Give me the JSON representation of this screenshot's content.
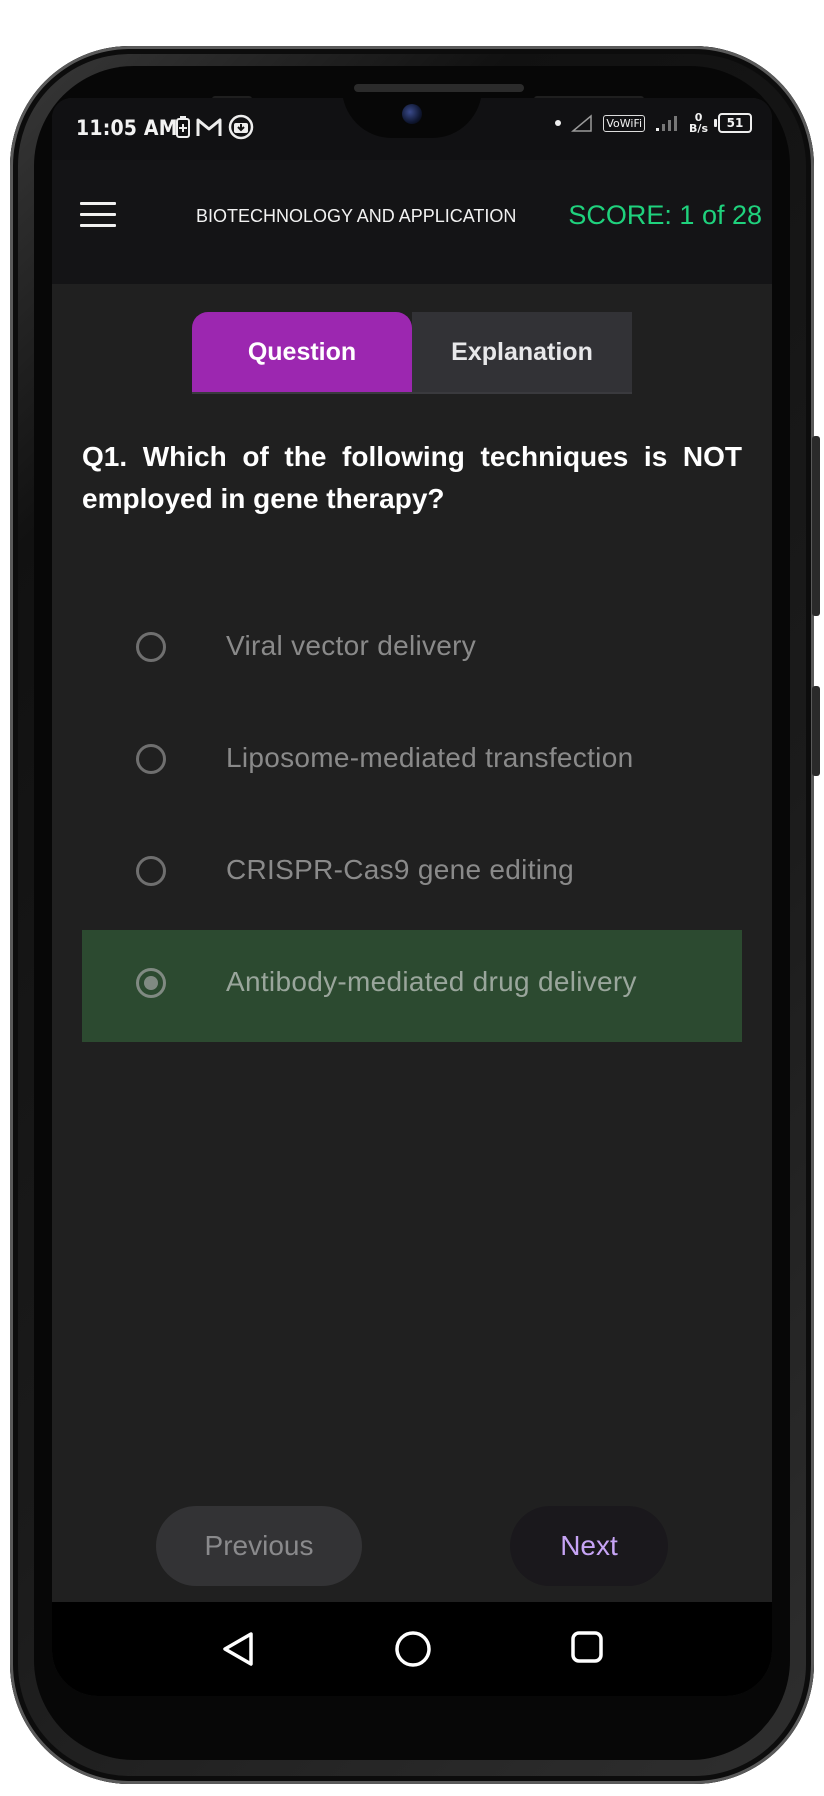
{
  "status_bar": {
    "time": "11:05 AM",
    "left_icons": [
      "battery-saver-icon",
      "gmail-icon",
      "download-icon"
    ],
    "vowifi": "VoWiFi",
    "net_speed_value": "0",
    "net_speed_unit": "B/s",
    "battery_level": "51"
  },
  "app_bar": {
    "title": "BIOTECHNOLOGY AND APPLICATION",
    "score": "SCORE: 1 of 28"
  },
  "tabs": [
    {
      "label": "Question",
      "active": true
    },
    {
      "label": "Explanation",
      "active": false
    }
  ],
  "question": {
    "text": "Q1. Which of the following techniques is NOT employed in gene therapy?"
  },
  "options": [
    {
      "label": "Viral vector delivery",
      "selected": false
    },
    {
      "label": "Liposome-mediated transfection",
      "selected": false
    },
    {
      "label": "CRISPR-Cas9 gene editing",
      "selected": false
    },
    {
      "label": "Antibody-mediated drug delivery",
      "selected": true
    }
  ],
  "buttons": {
    "previous": "Previous",
    "next": "Next"
  },
  "colors": {
    "accent": "#9c27b0",
    "score": "#1fd27d",
    "selected_option_bg": "#2c4a30",
    "next_text": "#c7a4f5"
  }
}
